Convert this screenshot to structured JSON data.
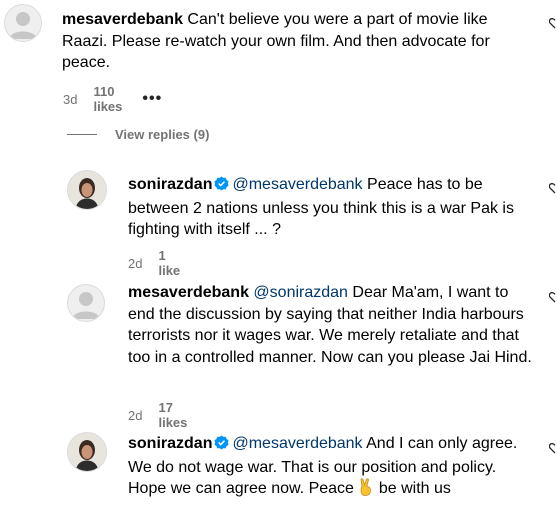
{
  "comments": [
    {
      "username": "mesaverdebank",
      "mention": "",
      "text": "Can't believe you were a part of movie like Raazi. Please re-watch your own film. And then advocate for peace.",
      "time": "3d",
      "likes": "110 likes",
      "more": "•••",
      "verified": false,
      "avatar": "default-avatar"
    },
    {
      "username": "sonirazdan",
      "mention": "@mesaverdebank",
      "text": "Peace has to be between 2 nations unless you think this is a war Pak is fighting with itself ... ?",
      "time": "2d",
      "likes": "1 like",
      "verified": true,
      "avatar": "profile-photo"
    },
    {
      "username": "mesaverdebank",
      "mention": "@sonirazdan",
      "text": "Dear Ma'am, I want to end the discussion by saying that neither India harbours terrorists nor it wages war. We merely retaliate and that too in a controlled manner. Now can you please Jai Hind.",
      "time": "2d",
      "likes": "17 likes",
      "verified": false,
      "avatar": "default-avatar"
    },
    {
      "username": "sonirazdan",
      "mention": "@mesaverdebank",
      "text": "And I can only agree. We do not wage war. That is our position and policy. Hope we can agree now. Peace",
      "text_after_emoji": "be with us",
      "emoji": "victory-hand-emoji",
      "verified": true,
      "avatar": "profile-photo"
    }
  ],
  "view_replies": "View replies (9)",
  "colors": {
    "meta": "#737373",
    "mention": "#00376b",
    "verified": "#0095f6"
  }
}
